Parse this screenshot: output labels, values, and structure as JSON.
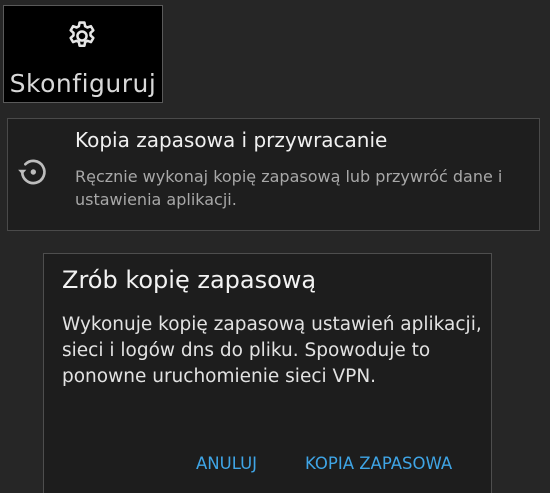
{
  "configure_tile": {
    "icon": "gear-icon",
    "label": "Skonfiguruj"
  },
  "backup_preference": {
    "icon": "restore-icon",
    "title": "Kopia zapasowa i przywracanie",
    "summary": "Ręcznie wykonaj kopię zapasową lub przywróć dane i ustawienia aplikacji."
  },
  "dialog": {
    "title": "Zrób kopię zapasową",
    "message": "Wykonuje kopię zapasową ustawień aplikacji, sieci i logów dns do pliku. Spowoduje to ponowne uruchomienie sieci VPN.",
    "cancel_label": "ANULUJ",
    "confirm_label": "KOPIA ZAPASOWA"
  },
  "colors": {
    "accent": "#3fa5e6",
    "background": "#262626",
    "dialog_background": "#1d1d1d"
  }
}
